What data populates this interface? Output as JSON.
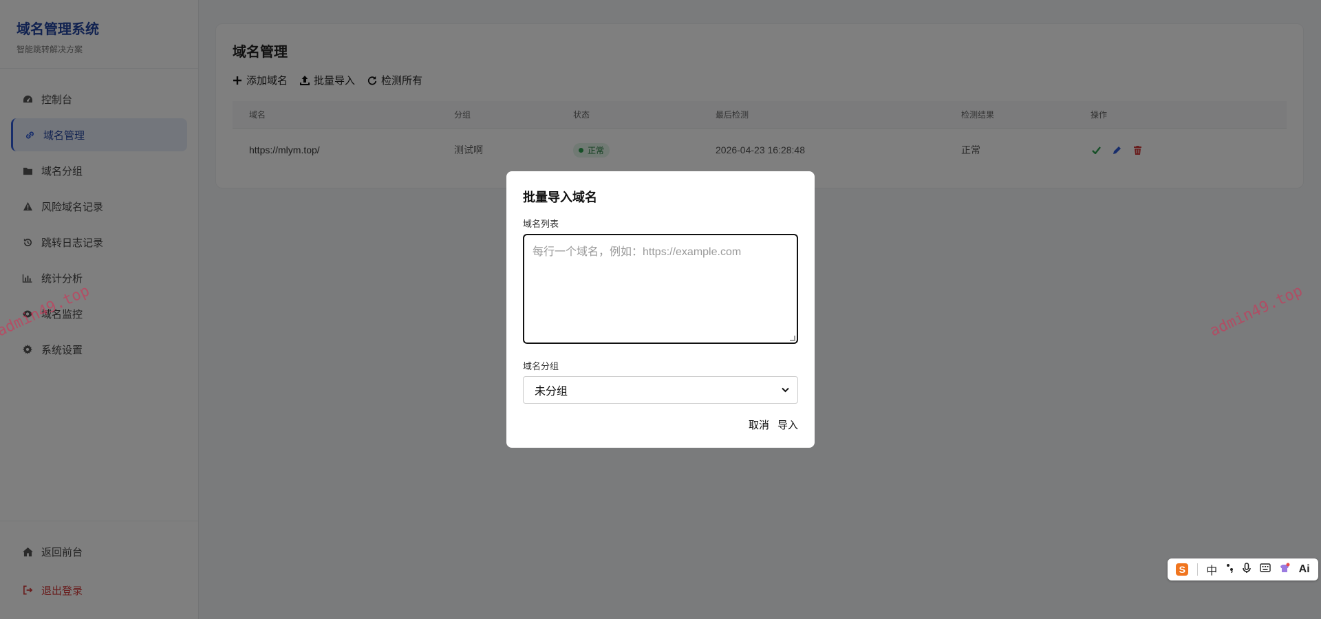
{
  "brand": {
    "title": "域名管理系统",
    "subtitle": "智能跳转解决方案"
  },
  "sidebar": {
    "items": [
      {
        "label": "控制台",
        "icon": "dashboard-icon"
      },
      {
        "label": "域名管理",
        "icon": "link-icon",
        "active": true
      },
      {
        "label": "域名分组",
        "icon": "folder-icon"
      },
      {
        "label": "风险域名记录",
        "icon": "warning-icon"
      },
      {
        "label": "跳转日志记录",
        "icon": "history-icon"
      },
      {
        "label": "统计分析",
        "icon": "bar-chart-icon"
      },
      {
        "label": "域名监控",
        "icon": "eye-icon"
      },
      {
        "label": "系统设置",
        "icon": "gear-icon"
      }
    ],
    "bottom": [
      {
        "label": "返回前台",
        "icon": "home-icon"
      },
      {
        "label": "退出登录",
        "icon": "logout-icon"
      }
    ]
  },
  "main": {
    "title": "域名管理",
    "toolbar": {
      "add": "添加域名",
      "import": "批量导入",
      "check_all": "检测所有"
    },
    "table": {
      "headers": [
        "域名",
        "分组",
        "状态",
        "最后检测",
        "检测结果",
        "操作"
      ],
      "rows": [
        {
          "domain": "https://mlym.top/",
          "group": "测试啊",
          "status": "正常",
          "last_check": "2026-04-23 16:28:48",
          "result": "正常"
        }
      ]
    }
  },
  "modal": {
    "title": "批量导入域名",
    "list_label": "域名列表",
    "list_placeholder": "每行一个域名，例如：https://example.com",
    "group_label": "域名分组",
    "group_selected": "未分组",
    "cancel": "取消",
    "confirm": "导入"
  },
  "watermark": "admin49.top",
  "ime": {
    "lang": "中",
    "ai": "Ai"
  },
  "colors": {
    "accent": "#2f5bd6",
    "brand": "#2344a0",
    "danger": "#d23b3b",
    "success": "#2d9f4f"
  }
}
